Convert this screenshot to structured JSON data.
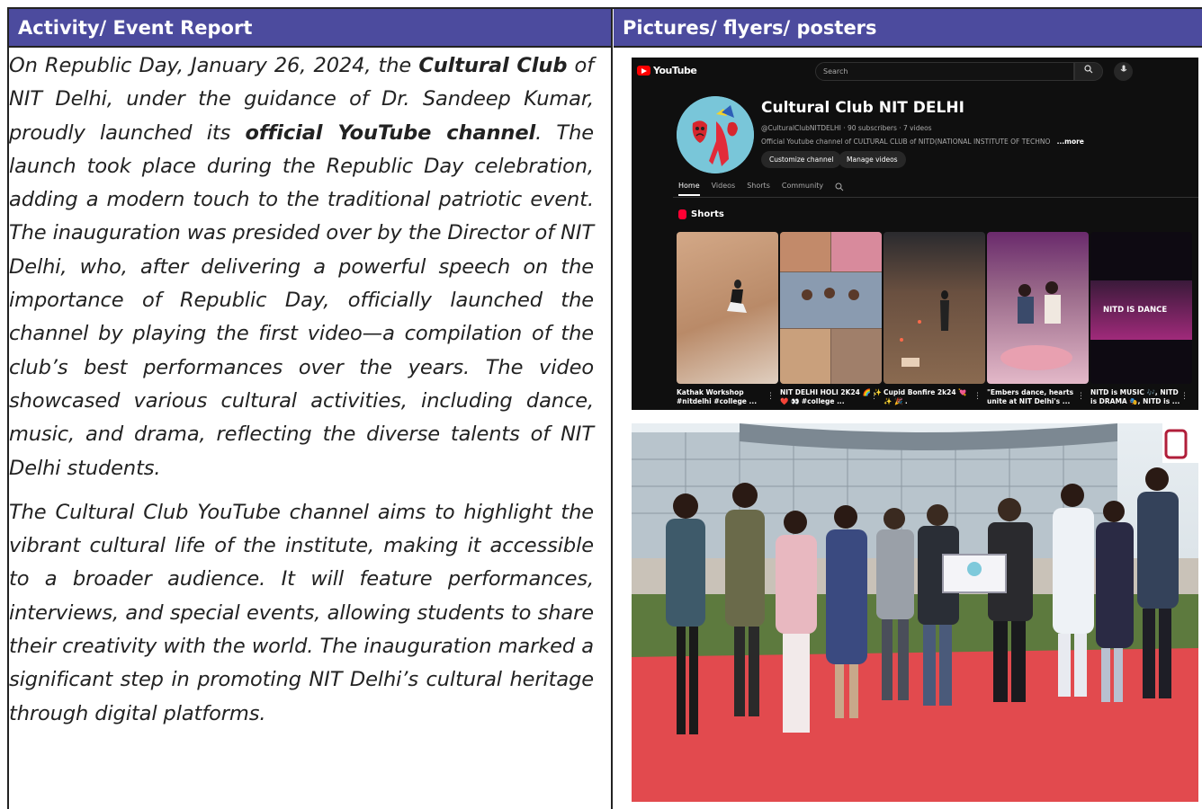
{
  "headers": {
    "left": "Activity/ Event Report",
    "right": "Pictures/ flyers/ posters"
  },
  "report": {
    "p1_a": "On Republic Day, January 26, 2024, the ",
    "p1_b": "Cultural Club",
    "p1_c": " of NIT Delhi, under the guidance of Dr. Sandeep Kumar, proudly launched its ",
    "p1_d": "official YouTube channel",
    "p1_e": ". The launch took place during the Republic Day celebration, adding a modern touch to the traditional patriotic event. The inauguration was presided over by the Director of NIT Delhi, who, after delivering a powerful speech on the importance of Republic Day, officially launched the channel by playing the first video—a compilation of the club’s best performances over the years. The video showcased various cultural activities, including dance, music, and drama, reflecting the diverse talents of NIT Delhi students.",
    "p2": "The Cultural Club YouTube channel aims to highlight the vibrant cultural life of the institute, making it accessible to a broader audience. It will feature performances, interviews, and special events, allowing students to share their creativity with the world. The inauguration marked a significant step in promoting NIT Delhi’s cultural heritage through digital platforms."
  },
  "youtube": {
    "logo": "YouTube",
    "search_placeholder": "Search",
    "channel_name": "Cultural Club NIT DELHI",
    "handle": "@CulturalClubNITDELHI · 90 subscribers · 7 videos",
    "description": "Official Youtube channel of CULTURAL CLUB of NITD(NATIONAL INSTITUTE OF TECHNO",
    "more": "...more",
    "customize_label": "Customize channel",
    "manage_label": "Manage videos",
    "tabs": [
      "Home",
      "Videos",
      "Shorts",
      "Community"
    ],
    "shorts_label": "Shorts",
    "shorts": [
      {
        "caption": "Kathak Workshop #nitdelhi #college ...",
        "color": "#c69a78"
      },
      {
        "caption": "NIT DELHI HOLI 2K24 🌈 ✨ ❤️ 👀 #college ...",
        "color": "#8a6d5a"
      },
      {
        "caption": "Cupid Bonfire 2k24 💘 ✨ 🎉 .",
        "color": "#6b5240"
      },
      {
        "caption": "\"Embers dance, hearts unite at NIT Delhi's ...",
        "color": "#5a2d5c"
      },
      {
        "caption": "NITD is MUSIC 🎶, NITD is DRAMA 🎭, NITD is ...",
        "color": "#1a1020"
      }
    ],
    "short5_overlay": "NITD IS DANCE"
  },
  "icons": {
    "search": "search-icon",
    "mic": "mic-icon"
  }
}
